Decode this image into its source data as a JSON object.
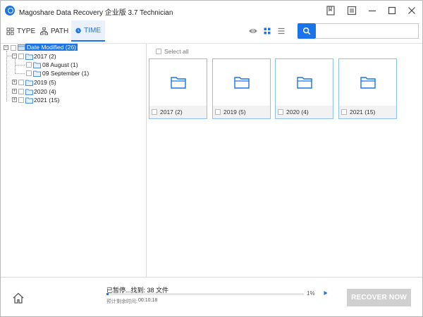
{
  "window": {
    "title": "Magoshare Data Recovery 企业版 3.7 Technician",
    "accent": "#1a73e8"
  },
  "titlebar_icons": [
    "bookmark-icon",
    "menu-icon",
    "minimize-icon",
    "maximize-icon",
    "close-icon"
  ],
  "tabs": [
    {
      "label": "TYPE",
      "icon": "grid-icon",
      "active": false
    },
    {
      "label": "PATH",
      "icon": "hierarchy-icon",
      "active": false
    },
    {
      "label": "TIME",
      "icon": "clock-icon",
      "active": true
    }
  ],
  "view_icons": [
    "eye-icon",
    "grid-view-icon",
    "list-view-icon"
  ],
  "search": {
    "placeholder": "",
    "value": ""
  },
  "tree": {
    "root": "Date Modified (26)",
    "nodes": [
      {
        "label": "2017 (2)",
        "expanded": true,
        "children": [
          "08 August (1)",
          "09 September (1)"
        ]
      },
      {
        "label": "2019 (5)",
        "expanded": false
      },
      {
        "label": "2020 (4)",
        "expanded": false
      },
      {
        "label": "2021 (15)",
        "expanded": false
      }
    ]
  },
  "content": {
    "select_all": "Select all",
    "cards": [
      {
        "label": "2017 (2)"
      },
      {
        "label": "2019 (5)"
      },
      {
        "label": "2020 (4)"
      },
      {
        "label": "2021 (15)"
      }
    ]
  },
  "bottom": {
    "status": "已暂停...找到: 38 文件",
    "progress_percent": 1,
    "percent_label": "1%",
    "remaining_label": "预计剩余时间:",
    "remaining_time": "00:10:18",
    "recover_label": "RECOVER NOW"
  }
}
